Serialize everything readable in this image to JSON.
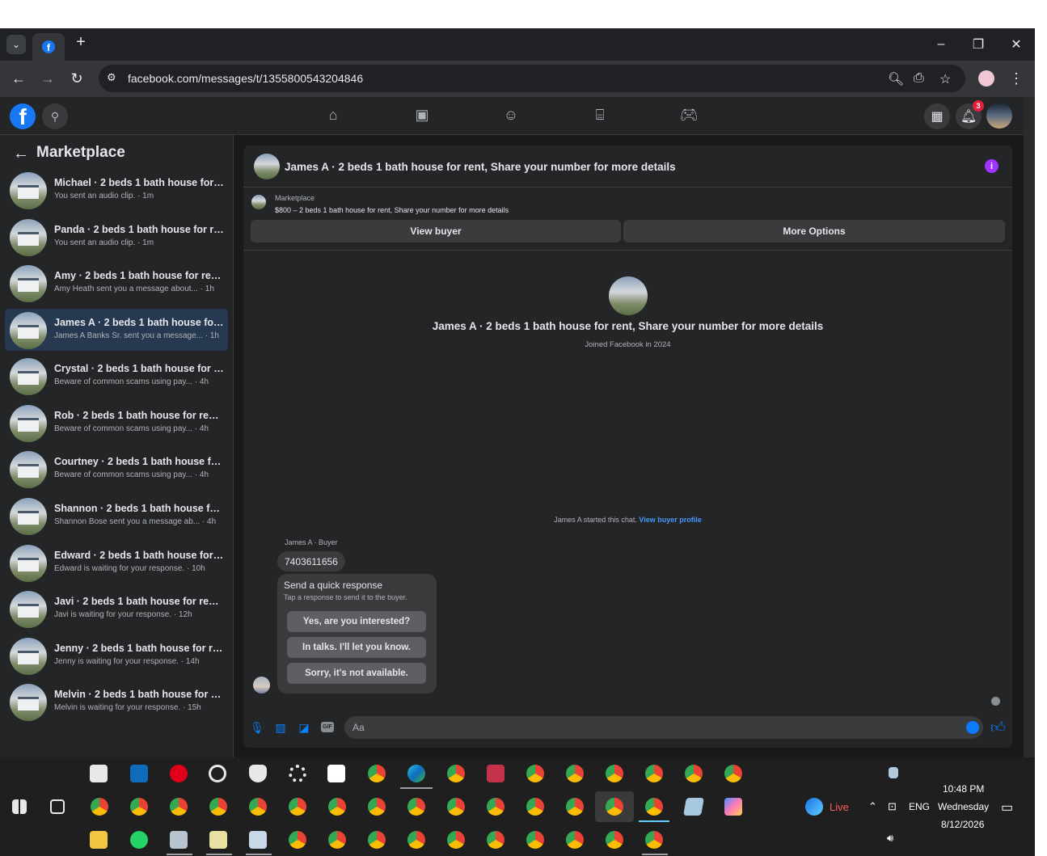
{
  "browser": {
    "url": "facebook.com/messages/t/1355800543204846",
    "tab_plus": "+",
    "win_min": "–",
    "win_restore": "❐",
    "win_close": "✕"
  },
  "fb": {
    "logo": "f",
    "notification_count": "3"
  },
  "sidebar": {
    "back": "←",
    "title": "Marketplace",
    "items": [
      {
        "name": "Michael · 2 beds 1 bath house for r...",
        "sub": "You sent an audio clip. · 1m"
      },
      {
        "name": "Panda · 2 beds 1 bath house for re...",
        "sub": "You sent an audio clip. · 1m"
      },
      {
        "name": "Amy · 2 beds 1 bath house for rent...",
        "sub": "Amy Heath sent you a message about... · 1h"
      },
      {
        "name": "James A · 2 beds 1 bath house for r...",
        "sub": "James A Banks Sr. sent you a message... · 1h"
      },
      {
        "name": "Crystal · 2 beds 1 bath house for re...",
        "sub": "Beware of common scams using pay... · 4h"
      },
      {
        "name": "Rob · 2 beds 1 bath house for rent,...",
        "sub": "Beware of common scams using pay... · 4h"
      },
      {
        "name": "Courtney · 2 beds 1 bath house for...",
        "sub": "Beware of common scams using pay... · 4h"
      },
      {
        "name": "Shannon · 2 beds 1 bath house for ...",
        "sub": "Shannon Bose sent you a message ab... · 4h"
      },
      {
        "name": "Edward · 2 beds 1 bath house for r...",
        "sub": "Edward is waiting for your response. · 10h"
      },
      {
        "name": "Javi · 2 beds 1 bath house for rent, ...",
        "sub": "Javi is waiting for your response. · 12h"
      },
      {
        "name": "Jenny · 2 beds 1 bath house for re...",
        "sub": "Jenny is waiting for your response. · 14h"
      },
      {
        "name": "Melvin · 2 beds 1 bath house for re...",
        "sub": "Melvin is waiting for your response. · 15h"
      }
    ]
  },
  "chat": {
    "header_title": "James A · 2 beds 1 bath house for rent, Share your number for more details",
    "info": "i",
    "marketplace_label": "Marketplace",
    "listing": "$800 – 2 beds 1 bath house for rent, Share your number for more details",
    "view_buyer": "View buyer",
    "more_options": "More Options",
    "profile_name": "James A · 2 beds 1 bath house for rent, Share your number for more details",
    "joined": "Joined Facebook in 2024",
    "started_text": "James A started this chat.",
    "view_buyer_profile": "View buyer profile",
    "sender_label": "James A · Buyer",
    "message": "7403611656",
    "quick_title": "Send a quick response",
    "quick_sub": "Tap a response to send it to the buyer.",
    "quick_responses": [
      "Yes, are you interested?",
      "In talks. I'll let you know.",
      "Sorry, it's not available."
    ],
    "input_placeholder": "Aa",
    "gif": "GIF"
  },
  "taskbar": {
    "live": "Live",
    "lang": "ENG",
    "time": "10:48 PM",
    "day": "Wednesday",
    "date": "8/12/2026"
  },
  "colors": {
    "accent": "#0a7cff",
    "fb_blue": "#1877f2",
    "bg_dark": "#18191a",
    "panel": "#242526"
  }
}
